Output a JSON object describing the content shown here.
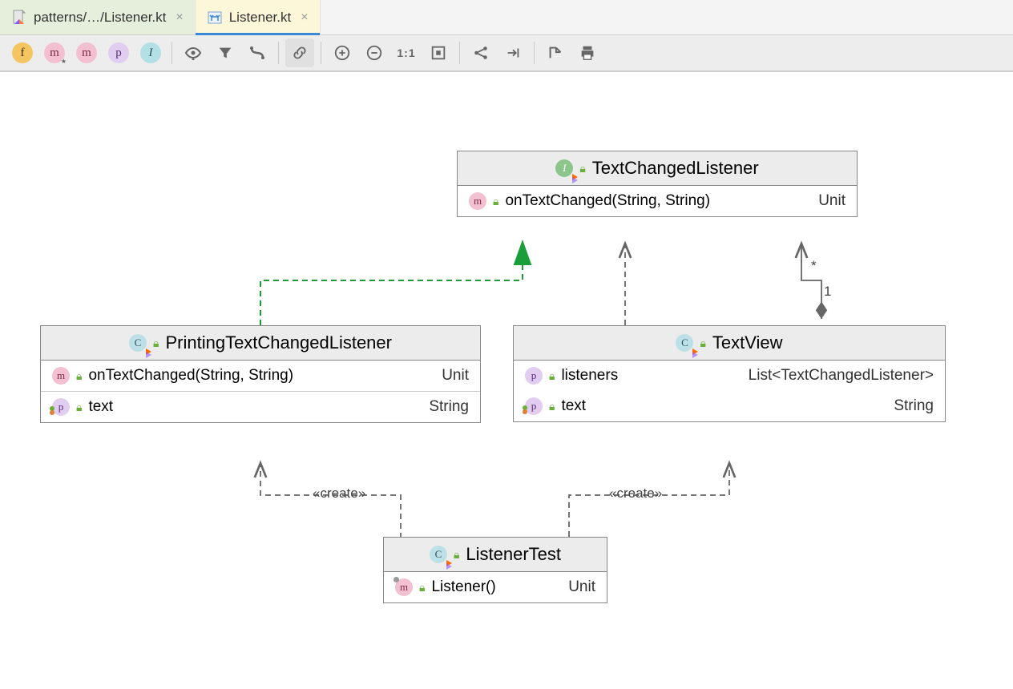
{
  "tabs": [
    {
      "label": "patterns/…/Listener.kt",
      "active": false
    },
    {
      "label": "Listener.kt",
      "active": true
    }
  ],
  "toolbar": {
    "buttons": [
      "f",
      "m-star",
      "m",
      "p",
      "i",
      "visibility",
      "filter",
      "layout",
      "link",
      "zoom-in",
      "zoom-out",
      "1-1",
      "fit",
      "deps",
      "target",
      "export",
      "print"
    ]
  },
  "classes": {
    "textChangedListener": {
      "name": "TextChangedListener",
      "kind": "interface",
      "members": {
        "onTextChanged": {
          "sig": "onTextChanged(String, String)",
          "ret": "Unit"
        }
      }
    },
    "printing": {
      "name": "PrintingTextChangedListener",
      "kind": "class",
      "methods": {
        "onTextChanged": {
          "sig": "onTextChanged(String, String)",
          "ret": "Unit"
        }
      },
      "props": {
        "text": {
          "name": "text",
          "type": "String"
        }
      }
    },
    "textView": {
      "name": "TextView",
      "kind": "class",
      "props": {
        "listeners": {
          "name": "listeners",
          "type": "List<TextChangedListener>"
        },
        "text": {
          "name": "text",
          "type": "String"
        }
      }
    },
    "listenerTest": {
      "name": "ListenerTest",
      "kind": "class",
      "methods": {
        "listener": {
          "sig": "Listener()",
          "ret": "Unit"
        }
      }
    }
  },
  "relations": {
    "create1": "«create»",
    "create2": "«create»",
    "mult_star": "*",
    "mult_one": "1"
  }
}
